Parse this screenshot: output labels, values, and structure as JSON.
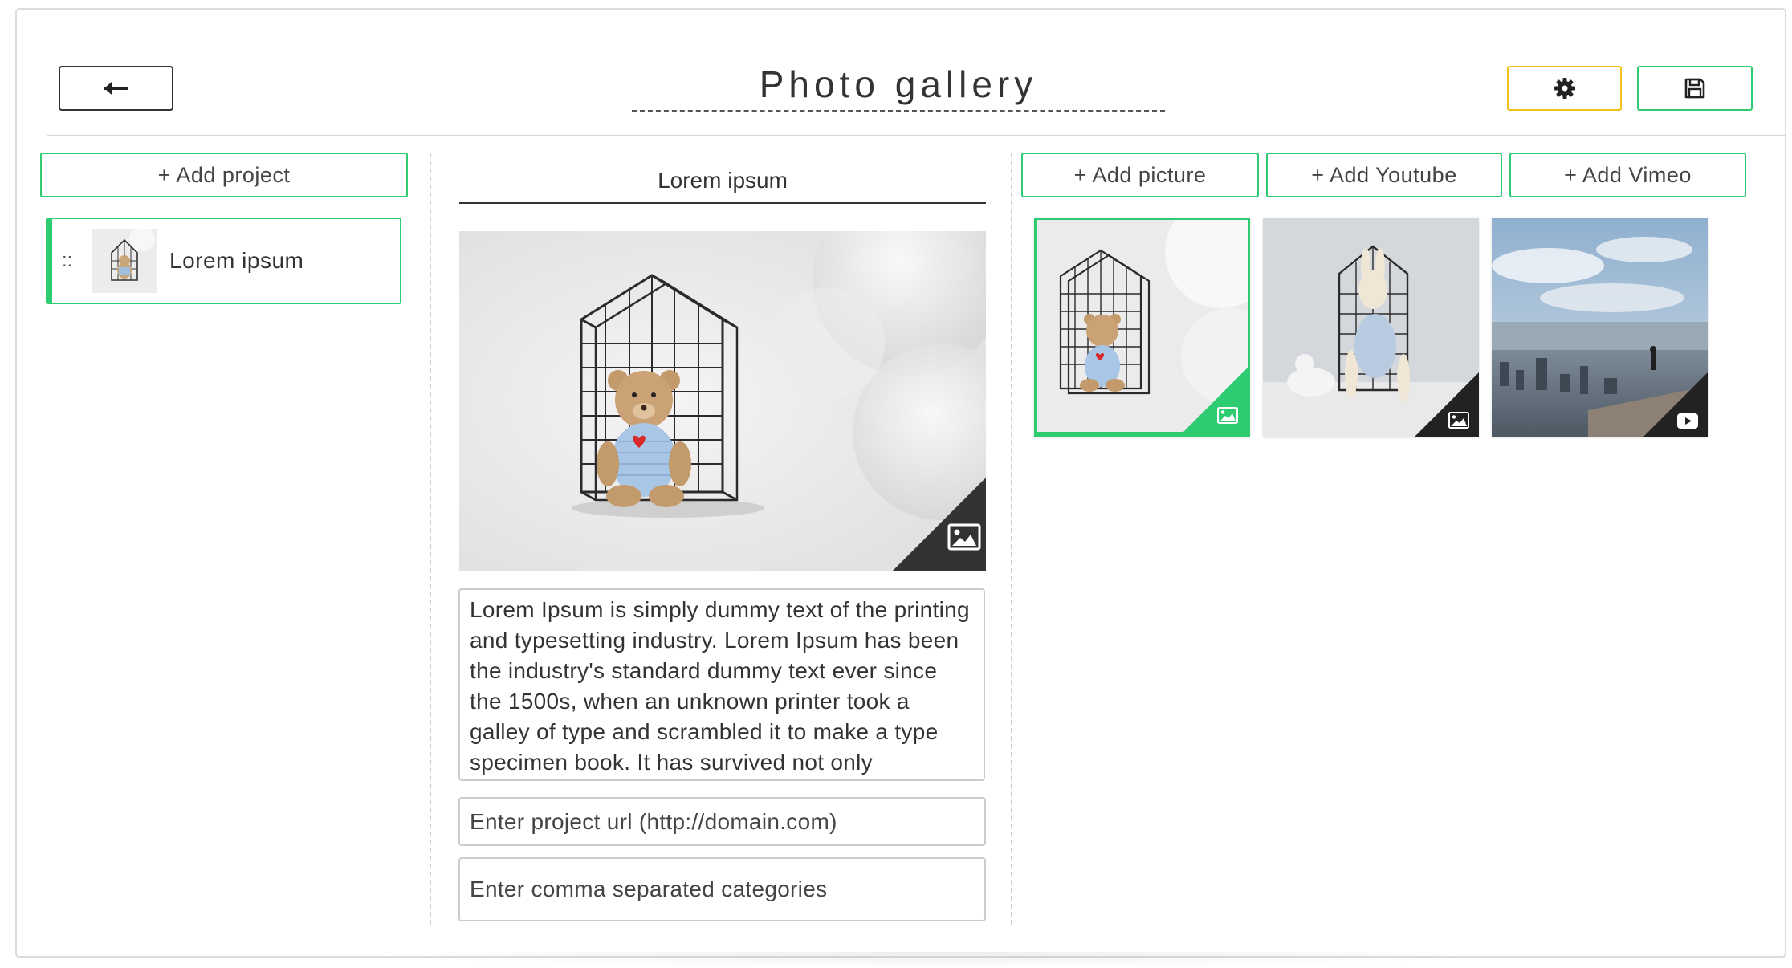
{
  "header": {
    "title": "Photo gallery",
    "back_icon": "arrow-left-icon",
    "settings_icon": "gear-icon",
    "save_icon": "floppy-disk-icon",
    "settings_border": "#f2c21a",
    "save_border": "#2ecc71"
  },
  "colors": {
    "accent": "#2ecc71",
    "warning": "#f2c21a",
    "text": "#333333",
    "border": "#cccccc"
  },
  "left": {
    "add_project_label": "+ Add project",
    "projects": [
      {
        "handle": "::",
        "name": "Lorem ipsum",
        "thumb": "teddy-cage-thumbnail"
      }
    ]
  },
  "middle": {
    "project_title": "Lorem ipsum",
    "main_image": "teddy-bear-in-wire-house",
    "image_badge_icon": "image-icon",
    "description": "Lorem Ipsum is simply dummy text of the printing and typesetting industry. Lorem Ipsum has been the industry's standard dummy text ever since the 1500s, when an unknown printer took a galley of type and scrambled it to make a type specimen book. It has survived not only",
    "url_placeholder": "Enter project url (http://domain.com)",
    "categories_placeholder": "Enter comma separated categories"
  },
  "right": {
    "add_picture_label": "+ Add picture",
    "add_youtube_label": "+ Add Youtube",
    "add_vimeo_label": "+ Add Vimeo",
    "media": [
      {
        "image": "teddy-bear-in-wire-house",
        "type_icon": "image-icon",
        "selected": true
      },
      {
        "image": "rabbit-doll-and-bird",
        "type_icon": "image-icon",
        "selected": false
      },
      {
        "image": "city-skyline-person",
        "type_icon": "play-video-icon",
        "selected": false
      }
    ]
  }
}
